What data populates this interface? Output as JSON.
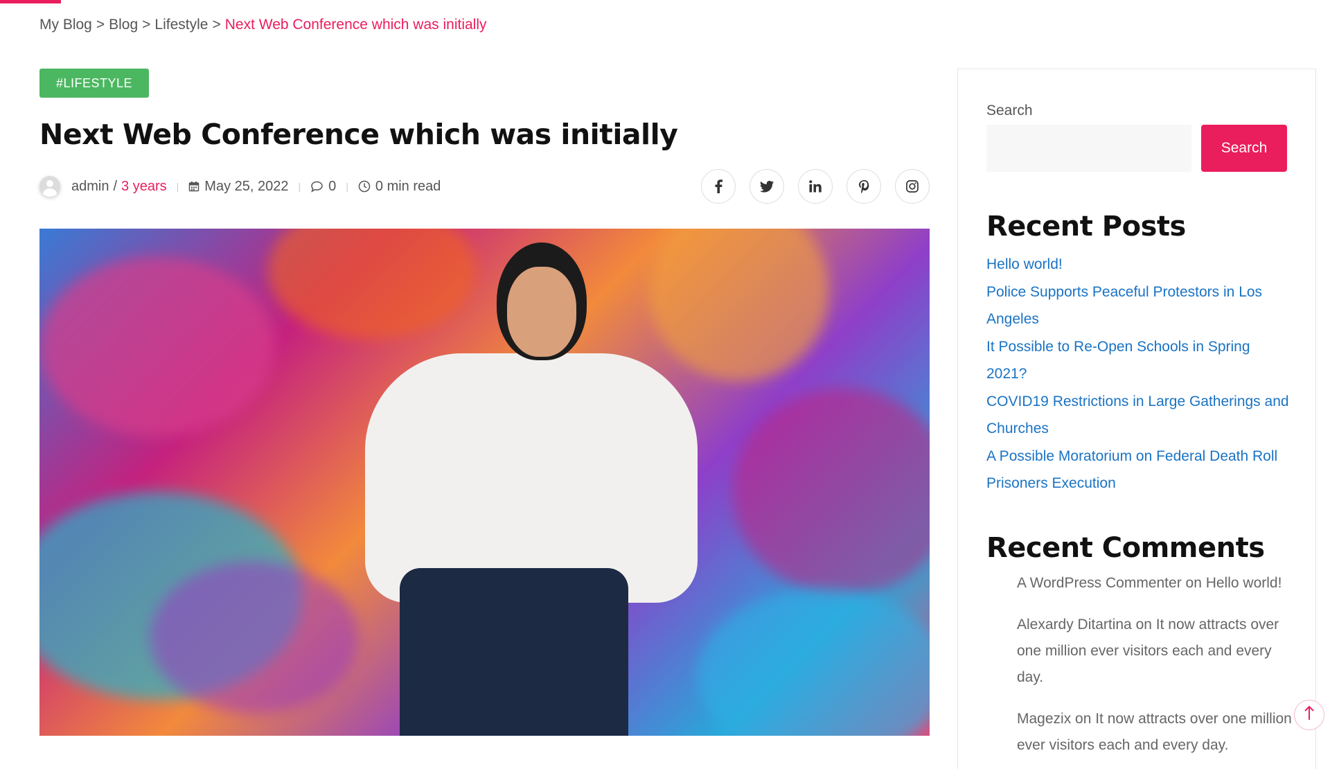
{
  "breadcrumb": {
    "items": [
      "My Blog",
      "Blog",
      "Lifestyle"
    ],
    "separator": ">",
    "current": "Next Web Conference which was initially"
  },
  "post": {
    "tag": "#LIFESTYLE",
    "title": "Next Web Conference which was initially",
    "author": "admin",
    "author_sep": "/",
    "time_ago": "3 years",
    "date": "May 25, 2022",
    "comments": "0",
    "read_time": "0 min read"
  },
  "share": {
    "icons": [
      "facebook-icon",
      "twitter-icon",
      "linkedin-icon",
      "pinterest-icon",
      "instagram-icon"
    ]
  },
  "sidebar": {
    "search_label": "Search",
    "search_placeholder": "",
    "search_button": "Search",
    "recent_posts_title": "Recent Posts",
    "recent_posts": [
      "Hello world!",
      "Police Supports Peaceful Protestors in Los Angeles",
      "It Possible to Re-Open Schools in Spring 2021?",
      "COVID19 Restrictions in Large Gatherings and Churches",
      "A Possible Moratorium on Federal Death Roll Prisoners Execution"
    ],
    "recent_comments_title": "Recent Comments",
    "recent_comments": [
      "A WordPress Commenter on Hello world!",
      "Alexardy Ditartina on It now attracts over one million ever visitors each and every day.",
      "Magezix on It now attracts over one million ever visitors each and every day."
    ]
  },
  "colors": {
    "accent": "#ea1d5d",
    "tag_bg": "#4cb761",
    "link": "#1a73c4"
  }
}
